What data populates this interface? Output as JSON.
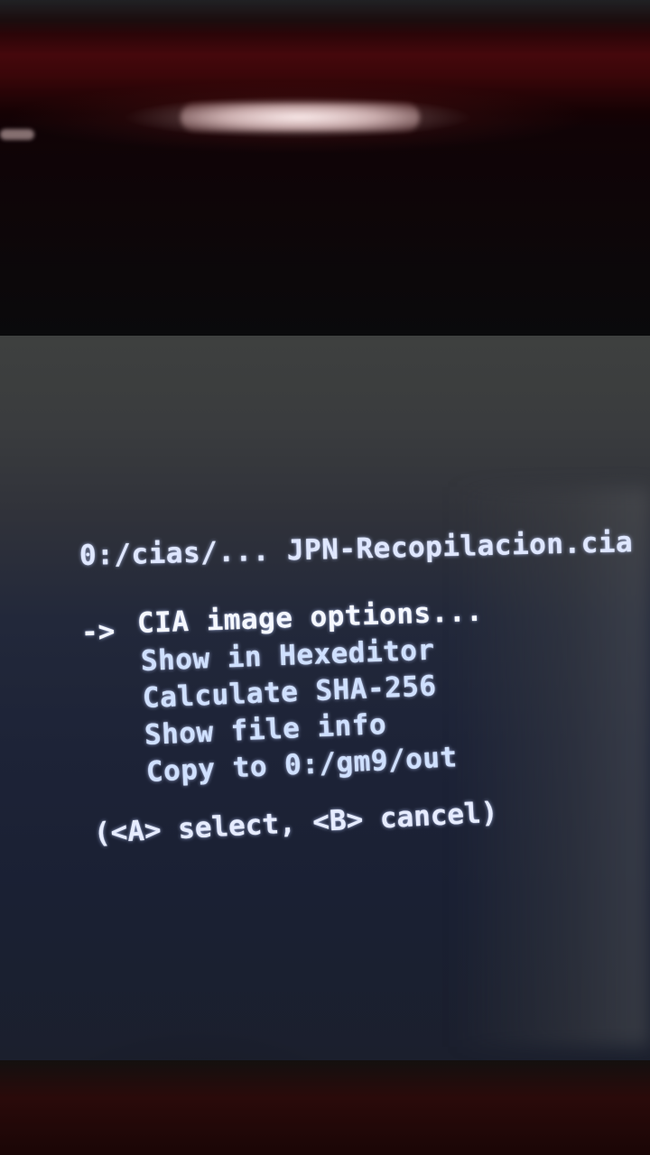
{
  "file_menu": {
    "path": "0:/cias/... JPN-Recopilacion.cia",
    "cursor": "->",
    "items": [
      {
        "label": "CIA image options...",
        "selected": true
      },
      {
        "label": "Show in Hexeditor",
        "selected": false
      },
      {
        "label": "Calculate SHA-256",
        "selected": false
      },
      {
        "label": "Show file info",
        "selected": false
      },
      {
        "label": "Copy to 0:/gm9/out",
        "selected": false
      }
    ],
    "hint": "(<A> select, <B> cancel)"
  }
}
